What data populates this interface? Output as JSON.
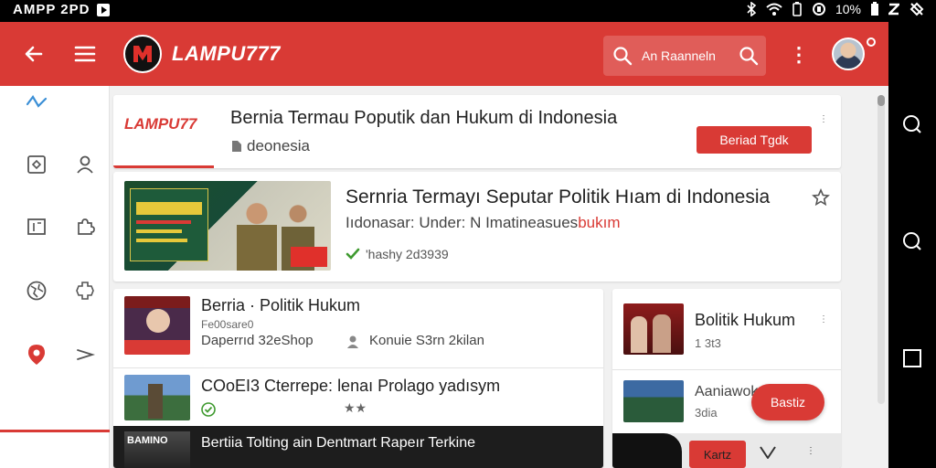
{
  "status_bar": {
    "left_text": "AMPP 2PD",
    "battery_text": "10%"
  },
  "header": {
    "app_name": "LAMPU777",
    "search_placeholder": "An Raanneln",
    "brand_color": "#d93a35"
  },
  "top_card": {
    "brand": "LAMPU77",
    "title": "Bernia Termau Poputik dan Hukum di Indonesia",
    "subtitle": "deonesia",
    "button_label": "Beriad Tgdk"
  },
  "featured": {
    "title": "Sernria Termayı Seputar Politik Hıam di Indonesia",
    "subtitle": "Iıdonasar: Under: N Imatineasues",
    "subtitle_highlight": "bukım",
    "meta": "'hashy 2d3939"
  },
  "list": [
    {
      "title": "Berria · Politik Hukum",
      "subtitle": "Fe00sare0",
      "meta_left": "Daperrıd 32eShop",
      "meta_right": "Konuie S3rn 2kilan"
    },
    {
      "title": "COoEI3 Cterrepe:  lenaı Prolago yadısym",
      "rating_label": "★★"
    },
    {
      "title": "Bertiia Tolting ain Dentmart Rapeır Terkine",
      "thumb_label": "BAMINO"
    }
  ],
  "right_card": {
    "item1": {
      "title": "Bolitik Hukum",
      "subtitle": "1 3t3"
    },
    "item2": {
      "title": "Aaniawok",
      "subtitle": "3dia"
    },
    "fab_label": "Bastiz",
    "bottom_button": "Kartz"
  },
  "icons": {
    "back": "back-arrow-icon",
    "menu": "hamburger-menu-icon",
    "search": "search-icon",
    "more": "kebab-icon",
    "star": "star-icon",
    "heart": "heart-icon"
  }
}
